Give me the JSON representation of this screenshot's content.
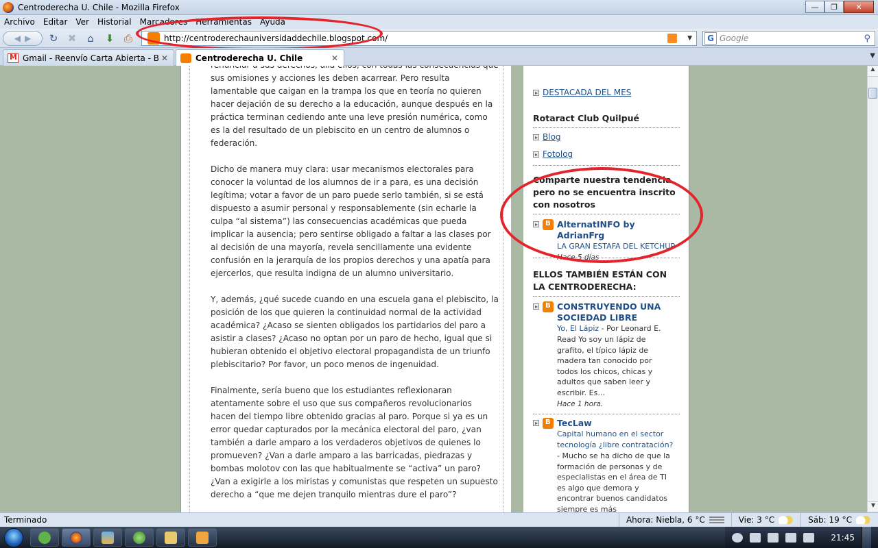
{
  "window": {
    "title": "Centroderecha U. Chile - Mozilla Firefox"
  },
  "menu": [
    "Archivo",
    "Editar",
    "Ver",
    "Historial",
    "Marcadores",
    "Herramientas",
    "Ayuda"
  ],
  "toolbar": {
    "url": "http://centroderechauniversidaddechile.blogspot.com/",
    "search_placeholder": "Google",
    "search_engine": "G"
  },
  "tabs": [
    {
      "label": "Gmail - Reenvío Carta Abierta - Blo...",
      "active": false,
      "icon": "gmail-icon"
    },
    {
      "label": "Centroderecha U. Chile",
      "active": true,
      "icon": "blogger-icon"
    }
  ],
  "post": {
    "paragraphs": [
      "renunciar a sus derechos, allá ellos, con todas las consecuencias que sus omisiones y acciones les deben acarrear. Pero resulta lamentable que caigan en la trampa los que en teoría no quieren hacer dejación de su derecho a la educación, aunque después en la práctica terminan cediendo ante una leve presión numérica, como es la del resultado de un plebiscito en un centro de alumnos o federación.",
      "Dicho de manera muy clara: usar mecanismos electorales para conocer la voluntad de los alumnos de ir a para, es una decisión legítima; votar a favor de un paro puede serlo también, si se está dispuesto a asumir personal y responsablemente (sin echarle la culpa “al sistema”) las consecuencias académicas que pueda implicar la ausencia; pero sentirse obligado a faltar a las clases por al decisión de una mayoría, revela sencillamente una evidente confusión en la jerarquía de los propios derechos y una apatía para ejercerlos, que resulta indigna de un alumno universitario.",
      "Y, además, ¿qué sucede cuando en una escuela gana el plebiscito, la posición de los que quieren la continuidad normal de la actividad académica? ¿Acaso se sienten obligados los partidarios del paro a asistir a clases? ¿Acaso no optan por un paro de hecho, igual que si hubieran obtenido el objetivo electoral propagandista de un triunfo plebiscitario? Por favor, un poco menos de ingenuidad.",
      "Finalmente, sería bueno que los estudiantes reflexionaran atentamente sobre el uso que sus compañeros revolucionarios hacen del tiempo libre obtenido gracias al paro. Porque si ya es un error quedar capturados por la mecánica electoral del paro, ¿van también a darle amparo a los verdaderos objetivos de quienes lo promueven? ¿Van a darle amparo a las barricadas, piedrazas y bombas molotov con las que habitualmente se “activa” un paro? ¿Van a exigirle a los miristas y comunistas que respeten un supuesto derecho a “que me dejen tranquilo mientras dure el paro”?"
    ]
  },
  "sidebar": {
    "top_link": "DESTACADA DEL MES",
    "rotaract": {
      "heading": "Rotaract Club Quilpué",
      "links": [
        "Blog",
        "Fotolog"
      ]
    },
    "comparte": {
      "heading": "Comparte nuestra tendencia pero no se encuentra inscrito con nosotros",
      "blog": {
        "title": "AlternatINFO by AdrianFrg",
        "post": "LA GRAN ESTAFA DEL KETCHUP",
        "time": "Hace 5 días"
      }
    },
    "ellos": {
      "heading": "ELLOS TAMBIÉN ESTÁN CON LA CENTRODERECHA:",
      "blogs": [
        {
          "title": "CONSTRUYENDO UNA SOCIEDAD LIBRE",
          "post": "Yo, El Lápiz",
          "snippet": " - Por Leonard E. Read Yo soy un lápiz de grafito, el típico lápiz de madera tan conocido por todos los chicos, chicas y adultos que saben leer y escribir. Es...",
          "time": "Hace 1 hora."
        },
        {
          "title": "TecLaw",
          "post": "Capital humano en el sector tecnología ¿libre contratación?",
          "snippet": " - Mucho se ha dicho de que la formación de personas y de especialistas en el área de TI es algo que demora y encontrar buenos candidatos siempre es más"
        }
      ]
    }
  },
  "status": {
    "text": "Terminado",
    "weather_now": "Ahora: Niebla, 6 °C",
    "weather_fri": "Vie: 3 °C",
    "weather_sat": "Sáb: 19 °C"
  },
  "taskbar": {
    "clock": "21:45"
  },
  "colors": {
    "annotation": "#e3242b",
    "page_bg": "#a9b9a4",
    "link": "#1f4f8a",
    "blogger": "#f57d00"
  }
}
